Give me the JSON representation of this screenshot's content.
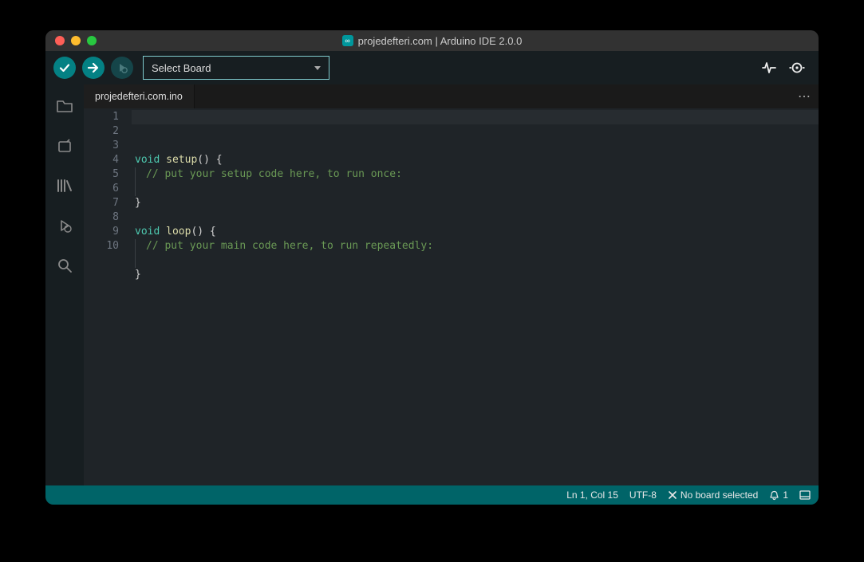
{
  "window": {
    "title": "projedefteri.com | Arduino IDE 2.0.0"
  },
  "toolbar": {
    "board_select_label": "Select Board"
  },
  "tabs": {
    "active": "projedefteri.com.ino"
  },
  "code": {
    "lines": [
      {
        "n": "1",
        "tokens": [
          {
            "t": "void",
            "c": "kw"
          },
          {
            "t": " ",
            "c": "pn"
          },
          {
            "t": "setup",
            "c": "fn"
          },
          {
            "t": "() {",
            "c": "pn"
          }
        ]
      },
      {
        "n": "2",
        "indent": true,
        "tokens": [
          {
            "t": "// put your setup code here, to run once:",
            "c": "cm"
          }
        ]
      },
      {
        "n": "3",
        "indent": true,
        "tokens": []
      },
      {
        "n": "4",
        "tokens": [
          {
            "t": "}",
            "c": "pn"
          }
        ]
      },
      {
        "n": "5",
        "tokens": []
      },
      {
        "n": "6",
        "tokens": [
          {
            "t": "void",
            "c": "kw"
          },
          {
            "t": " ",
            "c": "pn"
          },
          {
            "t": "loop",
            "c": "fn"
          },
          {
            "t": "() {",
            "c": "pn"
          }
        ]
      },
      {
        "n": "7",
        "indent": true,
        "tokens": [
          {
            "t": "// put your main code here, to run repeatedly:",
            "c": "cm"
          }
        ]
      },
      {
        "n": "8",
        "indent": true,
        "tokens": []
      },
      {
        "n": "9",
        "tokens": [
          {
            "t": "}",
            "c": "pn"
          }
        ]
      },
      {
        "n": "10",
        "tokens": []
      }
    ]
  },
  "statusbar": {
    "cursor": "Ln 1, Col 15",
    "encoding": "UTF-8",
    "board": "No board selected",
    "notifications": "1"
  }
}
